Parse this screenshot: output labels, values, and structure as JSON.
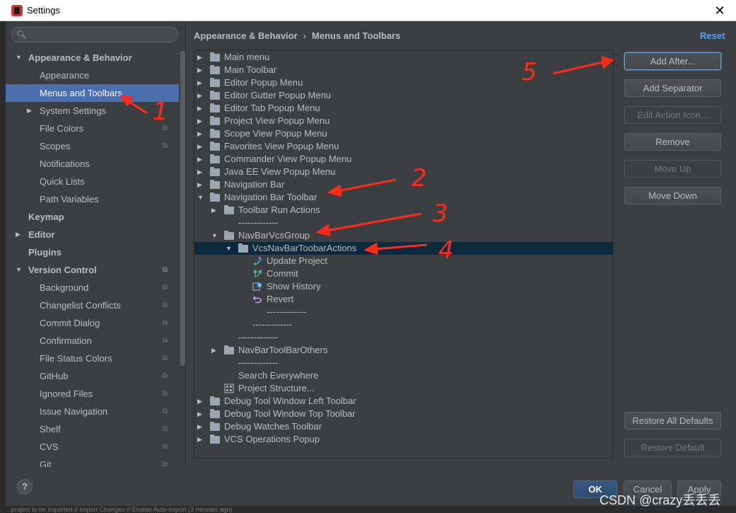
{
  "window": {
    "title": "Settings",
    "close_glyph": "✕"
  },
  "search": {
    "placeholder": "",
    "icon": "search-icon"
  },
  "sidebar": {
    "items": [
      {
        "label": "Appearance & Behavior"
      },
      {
        "label": "Appearance"
      },
      {
        "label": "Menus and Toolbars"
      },
      {
        "label": "System Settings"
      },
      {
        "label": "File Colors"
      },
      {
        "label": "Scopes"
      },
      {
        "label": "Notifications"
      },
      {
        "label": "Quick Lists"
      },
      {
        "label": "Path Variables"
      },
      {
        "label": "Keymap"
      },
      {
        "label": "Editor"
      },
      {
        "label": "Plugins"
      },
      {
        "label": "Version Control"
      },
      {
        "label": "Background"
      },
      {
        "label": "Changelist Conflicts"
      },
      {
        "label": "Commit Dialog"
      },
      {
        "label": "Confirmation"
      },
      {
        "label": "File Status Colors"
      },
      {
        "label": "GitHub"
      },
      {
        "label": "Ignored Files"
      },
      {
        "label": "Issue Navigation"
      },
      {
        "label": "Shelf"
      },
      {
        "label": "CVS"
      },
      {
        "label": "Git"
      }
    ]
  },
  "breadcrumb": {
    "parent": "Appearance & Behavior",
    "separator": "›",
    "current": "Menus and Toolbars"
  },
  "reset_label": "Reset",
  "tree": {
    "rows": [
      {
        "label": "Main menu"
      },
      {
        "label": "Main Toolbar"
      },
      {
        "label": "Editor Popup Menu"
      },
      {
        "label": "Editor Gutter Popup Menu"
      },
      {
        "label": "Editor Tab Popup Menu"
      },
      {
        "label": "Project View Popup Menu"
      },
      {
        "label": "Scope View Popup Menu"
      },
      {
        "label": "Favorites View Popup Menu"
      },
      {
        "label": "Commander View Popup Menu"
      },
      {
        "label": "Java EE View Popup Menu"
      },
      {
        "label": "Navigation Bar"
      },
      {
        "label": "Navigation Bar Toolbar"
      },
      {
        "label": "Toolbar Run Actions"
      },
      {
        "label": "-------------"
      },
      {
        "label": "NavBarVcsGroup"
      },
      {
        "label": "VcsNavBarToobarActions"
      },
      {
        "label": "Update Project"
      },
      {
        "label": "Commit"
      },
      {
        "label": "Show History"
      },
      {
        "label": "Revert"
      },
      {
        "label": "-------------"
      },
      {
        "label": "-------------"
      },
      {
        "label": "-------------"
      },
      {
        "label": "NavBarToolBarOthers"
      },
      {
        "label": "-------------"
      },
      {
        "label": "Search Everywhere"
      },
      {
        "label": "Project Structure..."
      },
      {
        "label": "Debug Tool Window Left Toolbar"
      },
      {
        "label": "Debug Tool Window Top Toolbar"
      },
      {
        "label": "Debug Watches Toolbar"
      },
      {
        "label": "VCS Operations Popup"
      }
    ]
  },
  "buttons": {
    "add_after": "Add After...",
    "add_separator": "Add Separator",
    "edit_action_icon": "Edit Action Icon...",
    "remove": "Remove",
    "move_up": "Move Up",
    "move_down": "Move Down",
    "restore_all_defaults": "Restore All Defaults",
    "restore_default": "Restore Default",
    "ok": "OK",
    "cancel": "Cancel",
    "apply": "Apply",
    "help": "?"
  },
  "annotations": [
    "1",
    "2",
    "3",
    "4",
    "5"
  ],
  "annotation_color": "#ff2a1a",
  "selection_color": "#4b6eaf",
  "statusbar_text": "...project to be imported // Import Changes // Enable Auto-Import (3 minutes ago)",
  "watermark": "CSDN @crazy丢丢丢"
}
